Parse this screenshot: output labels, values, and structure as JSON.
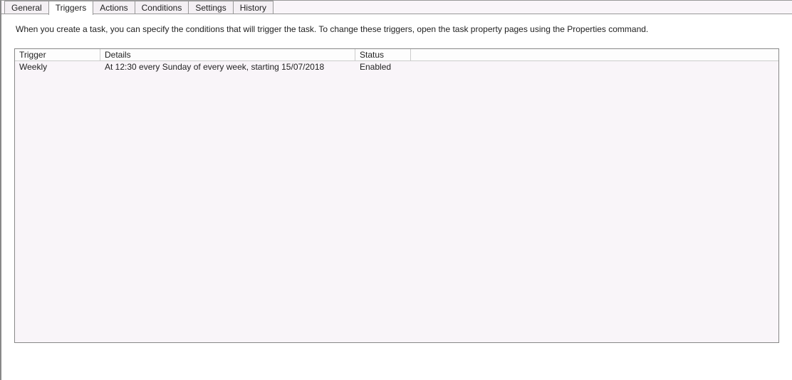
{
  "tabs": {
    "general": "General",
    "triggers": "Triggers",
    "actions": "Actions",
    "conditions": "Conditions",
    "settings": "Settings",
    "history": "History"
  },
  "description": "When you create a task, you can specify the conditions that will trigger the task.  To change these triggers, open the task property pages using the Properties command.",
  "columns": {
    "trigger": "Trigger",
    "details": "Details",
    "status": "Status"
  },
  "rows": [
    {
      "trigger": "Weekly",
      "details": "At 12:30 every Sunday of every week, starting 15/07/2018",
      "status": "Enabled"
    }
  ]
}
